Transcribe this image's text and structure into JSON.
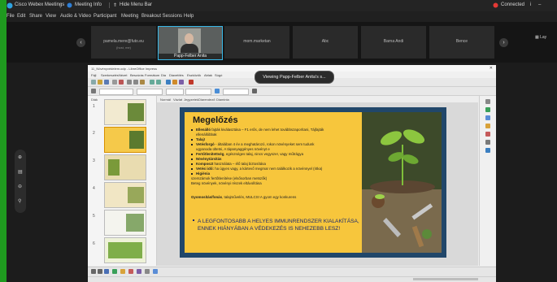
{
  "titlebar": {
    "app_title": "Cisco Webex Meetings",
    "tab_meeting_info": "Meeting Info",
    "tab_hide_menu": "Hide Menu Bar",
    "status": "Connected",
    "layout_label": "Lay"
  },
  "menu": {
    "items": [
      "File",
      "Edit",
      "Share",
      "View",
      "Audio & Video",
      "Participant",
      "Meeting",
      "Breakout Sessions",
      "Help"
    ]
  },
  "participants": [
    {
      "name": "pamela.mere@futo.eu",
      "sub": "(host, me)"
    },
    {
      "name": "Papp-Felber Anita",
      "sub": ""
    },
    {
      "name": "mom.marketan",
      "sub": ""
    },
    {
      "name": "Abc",
      "sub": ""
    },
    {
      "name": "Barna Andi",
      "sub": ""
    },
    {
      "name": "Bence",
      "sub": ""
    }
  ],
  "viewing_tooltip": "Viewing Papp-Felber Anita's s...",
  "doc": {
    "window_title": "11_Növényvédelem.odp - LibreOffice Impress",
    "menu": [
      "Fájl",
      "Szerkesztés",
      "Nézet",
      "Beszúrás",
      "Formátum",
      "Dia",
      "Diavetítés",
      "Eszközök",
      "Ablak",
      "Súgó"
    ],
    "view_tabs": [
      "Normál",
      "Vázlat",
      "Jegyzetek",
      "Diarendező",
      "Diaminta"
    ],
    "slides_label": "Diák",
    "slide_numbers": [
      "1",
      "2",
      "3",
      "4",
      "5",
      "6"
    ]
  },
  "slide": {
    "title": "Megelőzés",
    "lines": [
      {
        "bold": "Ellenálló",
        "text": " fajták kiválasztása – F1 erős, de nem lehet továbbszaporítani, Tájfajták"
      },
      {
        "bold": "",
        "text": "ellenállóbbak"
      },
      {
        "bold": "Talaj!",
        "text": ""
      },
      {
        "bold": "Vetésforgó",
        "text": " - általában 4 év a meghatározó, rokon növényeket sem tudunk"
      },
      {
        "bold": "",
        "text": "ugyanoda ültetni, A tápanyaggényes növényt e"
      },
      {
        "bold": "Fertőtlenítettség",
        "text": ", egészséges talaj, nincs vegyszer, vagy műtrágya"
      },
      {
        "bold": "Növénytársítás",
        "text": ""
      },
      {
        "bold": "Komposzt",
        "text": " használata – élő talaj biztosítása"
      },
      {
        "bold": "Vetési idő:",
        "text": " ha úgyes vagy, a kártevő megmar nem találkozik a növénnyel (ritka)"
      },
      {
        "bold": "Higiénia",
        "text": ""
      },
      {
        "bold": "",
        "text": "szerszámok fertőtlenítése (elsősorban metszők)"
      },
      {
        "bold": "",
        "text": "Beteg növények, növényi részek eltávolítása"
      },
      {
        "bold": "Gyomosítás/fonás",
        "text": ", talajművelés, MULCS! A gyom egy konkurens"
      }
    ],
    "emphasis": "A LEGFONTOSABB A HELYES IMMUNRENDSZER KIALAKÍTÁSA, ENNEK HIÁNYÁBAN A VÉDEKEZÉS IS NEHEZEBB LESZ!"
  },
  "colors": {
    "accent_green": "#1f9a1f",
    "slide_yellow": "#f7c63c",
    "slide_navy": "#21476a",
    "status_red": "#e53935"
  }
}
